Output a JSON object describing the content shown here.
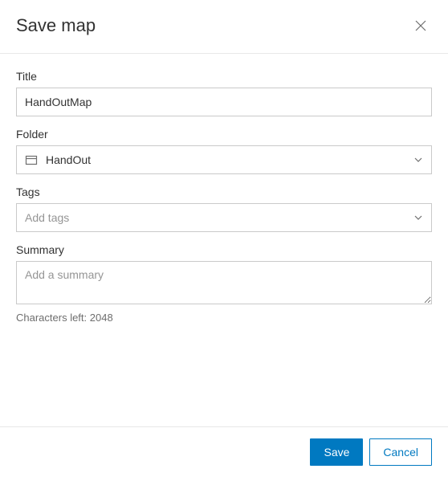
{
  "header": {
    "title": "Save map"
  },
  "form": {
    "title": {
      "label": "Title",
      "value": "HandOutMap"
    },
    "folder": {
      "label": "Folder",
      "value": "HandOut"
    },
    "tags": {
      "label": "Tags",
      "placeholder": "Add tags"
    },
    "summary": {
      "label": "Summary",
      "placeholder": "Add a summary",
      "charCount": "Characters left: 2048"
    }
  },
  "footer": {
    "save": "Save",
    "cancel": "Cancel"
  }
}
